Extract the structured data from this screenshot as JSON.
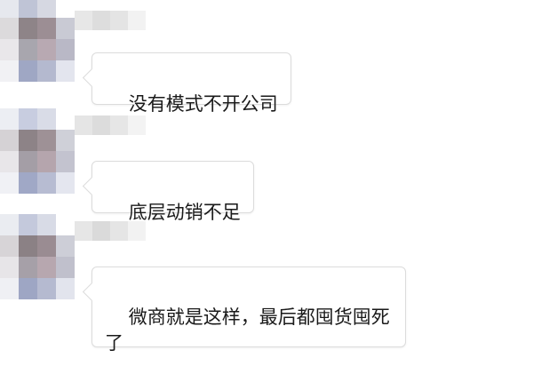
{
  "messages": [
    {
      "avatar_icon": "pixelated-avatar",
      "nickname_hidden": true,
      "text": "没有模式不开公司"
    },
    {
      "avatar_icon": "pixelated-avatar",
      "nickname_hidden": true,
      "text": "底层动销不足"
    },
    {
      "avatar_icon": "pixelated-avatar",
      "nickname_hidden": true,
      "text": "微商就是这样，最后都囤货囤死\n了"
    }
  ],
  "colors": {
    "background": "#ffffff",
    "bubble_border": "#dcdcdc",
    "text": "#1a1a1a"
  }
}
